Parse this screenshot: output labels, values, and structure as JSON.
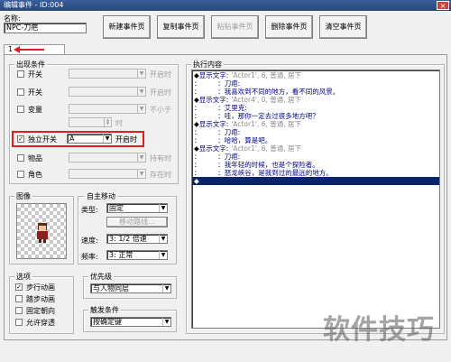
{
  "window": {
    "title": "编辑事件 - ID:004",
    "close": "×"
  },
  "name": {
    "label": "名称:",
    "value": "NPC-刀疤"
  },
  "toolbar": {
    "new_page": "新建事件页",
    "copy_page": "复制事件页",
    "paste_page": "粘贴事件页",
    "delete_page": "删除事件页",
    "clear_page": "清空事件页"
  },
  "tabs": [
    {
      "label": "1"
    }
  ],
  "conditions": {
    "title": "出现条件",
    "switch1": {
      "label": "开关",
      "suffix": "开启时"
    },
    "switch2": {
      "label": "开关",
      "suffix": "开启时"
    },
    "variable": {
      "label": "变量",
      "suffix": "不小于"
    },
    "variable_unit": "时",
    "self_switch": {
      "label": "独立开关",
      "value": "A",
      "suffix": "开启时"
    },
    "item": {
      "label": "物品",
      "suffix": "持有时"
    },
    "actor": {
      "label": "角色",
      "suffix": "存在时"
    }
  },
  "image": {
    "title": "图像"
  },
  "autonomous": {
    "title": "自主移动",
    "type_label": "类型:",
    "type_value": "固定",
    "route_button": "移动路线...",
    "speed_label": "速度:",
    "speed_value": "3: 1/2 倍速",
    "freq_label": "频率:",
    "freq_value": "3: 正常"
  },
  "options": {
    "title": "选项",
    "items": [
      {
        "label": "步行动画",
        "checked": "✓"
      },
      {
        "label": "踏步动画",
        "checked": ""
      },
      {
        "label": "固定朝向",
        "checked": ""
      },
      {
        "label": "允许穿透",
        "checked": ""
      }
    ]
  },
  "priority": {
    "title": "优先级",
    "value": "与人物同层"
  },
  "trigger": {
    "title": "触发条件",
    "value": "按确定键"
  },
  "contents": {
    "title": "执行内容",
    "lines": [
      {
        "m": "◆",
        "t": "显示文字:",
        "g": "'Actor1', 6, 普通, 居下"
      },
      {
        "m": "：",
        "t": "　　　：刀疤:",
        "g": ""
      },
      {
        "m": "：",
        "t": "　　　：我喜欢到不同的地方，看不同的风景。",
        "g": ""
      },
      {
        "m": "◆",
        "t": "显示文字:",
        "g": "'Actor4', 0, 普通, 居下"
      },
      {
        "m": "：",
        "t": "　　　：艾里克:",
        "g": ""
      },
      {
        "m": "：",
        "t": "　　　：哇，那你一定去过很多地方吧？",
        "g": ""
      },
      {
        "m": "◆",
        "t": "显示文字:",
        "g": "'Actor1', 6, 普通, 居下"
      },
      {
        "m": "：",
        "t": "　　　：刀疤:",
        "g": ""
      },
      {
        "m": "：",
        "t": "　　　：哈哈，算是吧。",
        "g": ""
      },
      {
        "m": "◆",
        "t": "显示文字:",
        "g": "'Actor1', 6, 普通, 居下"
      },
      {
        "m": "：",
        "t": "　　　：刀疤:",
        "g": ""
      },
      {
        "m": "：",
        "t": "　　　：我年轻的时候，也是个探险者。",
        "g": ""
      },
      {
        "m": "：",
        "t": "　　　：怒龙峡谷，是我到过的最远的地方。",
        "g": ""
      }
    ],
    "last": "◆"
  },
  "watermark": "软件技巧",
  "colors": {
    "highlight_box": "#e02020",
    "selection": "#0a246a",
    "gray_text": "#8a8a8a"
  }
}
